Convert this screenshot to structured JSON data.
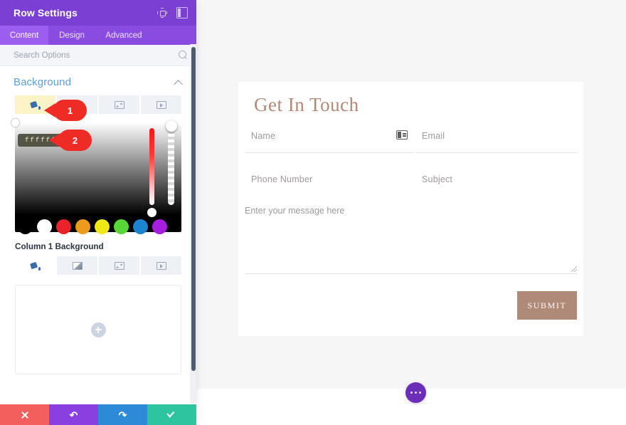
{
  "panel": {
    "title": "Row Settings",
    "header_icons": [
      {
        "name": "expand-icon",
        "label": "Expand"
      },
      {
        "name": "layout-toggle-icon",
        "label": "Layout"
      }
    ],
    "tabs": [
      {
        "label": "Content",
        "active": true
      },
      {
        "label": "Design",
        "active": false
      },
      {
        "label": "Advanced",
        "active": false
      }
    ],
    "search": {
      "placeholder": "Search Options",
      "value": ""
    },
    "sections": {
      "background": {
        "title": "Background",
        "tabs": [
          {
            "name": "background-color-tab",
            "icon": "paint-bucket-icon",
            "state": "highlighted"
          },
          {
            "name": "background-gradient-tab",
            "icon": "gradient-icon",
            "state": "default"
          },
          {
            "name": "background-image-tab",
            "icon": "image-icon",
            "state": "default"
          },
          {
            "name": "background-video-tab",
            "icon": "video-icon",
            "state": "default"
          }
        ],
        "color_picker": {
          "hex_tooltip": "ffffff",
          "swatches": [
            "#000000",
            "#ffffff",
            "#e8242a",
            "#ed9b1d",
            "#f0e815",
            "#58d638",
            "#1b84d1",
            "#a81ee0"
          ]
        }
      },
      "column1": {
        "title": "Column 1 Background",
        "tabs": [
          {
            "name": "column-background-color-tab",
            "icon": "paint-bucket-icon",
            "state": "active"
          },
          {
            "name": "column-background-gradient-tab",
            "icon": "gradient-icon",
            "state": "default"
          },
          {
            "name": "column-background-image-tab",
            "icon": "image-icon",
            "state": "default"
          },
          {
            "name": "column-background-video-tab",
            "icon": "video-icon",
            "state": "default"
          }
        ],
        "dropzone": {
          "icon": "plus-icon"
        }
      }
    },
    "footer": [
      {
        "name": "cancel-button",
        "icon": "close-icon",
        "color": "#f25f5c"
      },
      {
        "name": "undo-button",
        "icon": "undo-arrow-icon",
        "color": "#8a3fe0"
      },
      {
        "name": "redo-button",
        "icon": "redo-arrow-icon",
        "color": "#2d8ad6"
      },
      {
        "name": "save-button",
        "icon": "check-icon",
        "color": "#2ec4a0"
      }
    ]
  },
  "callouts": [
    {
      "id": "1",
      "label": "1"
    },
    {
      "id": "2",
      "label": "2"
    }
  ],
  "page": {
    "form": {
      "title": "Get In Touch",
      "title_color": "#b08a78",
      "fields": [
        {
          "name": "name-field",
          "placeholder": "Name",
          "value": "",
          "icon": "contact-card-icon"
        },
        {
          "name": "email-field",
          "placeholder": "Email",
          "value": ""
        },
        {
          "name": "phone-field",
          "placeholder": "Phone Number",
          "value": ""
        },
        {
          "name": "subject-field",
          "placeholder": "Subject",
          "value": ""
        }
      ],
      "message": {
        "placeholder": "Enter your message here",
        "value": ""
      },
      "submit_label": "SUBMIT",
      "submit_color": "#b08a78"
    },
    "fab": {
      "icon": "ellipsis-icon"
    }
  }
}
